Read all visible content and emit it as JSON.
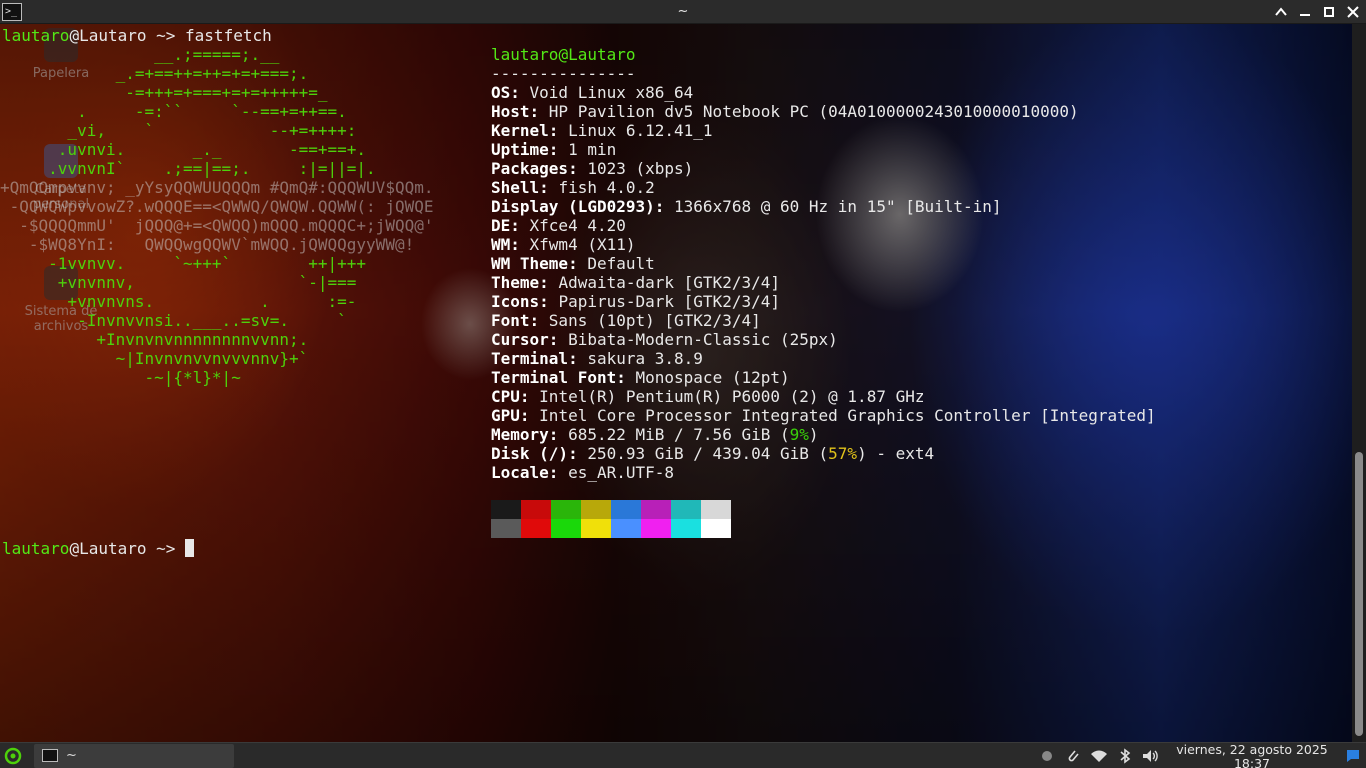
{
  "window": {
    "title": "~",
    "buttons": {
      "maximize": "⌃",
      "minimize": "—",
      "restore": "▫",
      "close": "✕"
    }
  },
  "desktop_icons": [
    {
      "label": "Papelera"
    },
    {
      "label": "Carpeta personal"
    },
    {
      "label": "Sistema de archivos"
    }
  ],
  "terminal": {
    "prompt_user": "lautaro",
    "prompt_host": "@Lautaro",
    "prompt_dir": " ~> ",
    "command": "fastfetch",
    "ascii_logo": [
      "                __.;=====;.__",
      "            _.=+==++=++=+=+===;.",
      "             -=+++=+===+=+=+++++=_",
      "        .     -=:``     `--==+=++==.",
      "       _vi,    `            --+=++++:",
      "      .uvnvi.       _._       -==+==+.",
      "     .vvnvnI`    .;==|==;.     :|=||=|.",
      "+QmQQmpvvnv; _yYsyQQWUUQQQm #QmQ#:QQQWUV$QQm.",
      " -QQWQWpvvowZ?.wQQQE==<QWWQ/QWQW.QQWW(: jQWQE",
      "  -$QQQQmmU'  jQQQ@+=<QWQQ)mQQQ.mQQQC+;jWQQ@'",
      "   -$WQ8YnI:   QWQQwgQQWV`mWQQ.jQWQQgyyWW@!",
      "     -1vvnvv.     `~+++`        ++|+++",
      "      +vnvnnv,                 `-|===",
      "       +vnvnvns.           .      :=-",
      "        -Invnvvnsi..___..=sv=.     `",
      "          +Invnvnvnnnnnnnnvvnn;.",
      "            ~|Invnvnvvnvvvnnv}+`",
      "               -~|{*l}*|~"
    ],
    "info_user": "lautaro",
    "info_host": "@Lautaro",
    "separator": "---------------",
    "info": [
      {
        "label": "OS",
        "value": "Void Linux x86_64"
      },
      {
        "label": "Host",
        "value": "HP Pavilion dv5 Notebook PC (04A0100000243010000010000)"
      },
      {
        "label": "Kernel",
        "value": "Linux 6.12.41_1"
      },
      {
        "label": "Uptime",
        "value": "1 min"
      },
      {
        "label": "Packages",
        "value": "1023 (xbps)"
      },
      {
        "label": "Shell",
        "value": "fish 4.0.2"
      },
      {
        "label": "Display (LGD0293)",
        "value": "1366x768 @ 60 Hz in 15\" [Built-in]"
      },
      {
        "label": "DE",
        "value": "Xfce4 4.20"
      },
      {
        "label": "WM",
        "value": "Xfwm4 (X11)"
      },
      {
        "label": "WM Theme",
        "value": "Default"
      },
      {
        "label": "Theme",
        "value": "Adwaita-dark [GTK2/3/4]"
      },
      {
        "label": "Icons",
        "value": "Papirus-Dark [GTK2/3/4]"
      },
      {
        "label": "Font",
        "value": "Sans (10pt) [GTK2/3/4]"
      },
      {
        "label": "Cursor",
        "value": "Bibata-Modern-Classic (25px)"
      },
      {
        "label": "Terminal",
        "value": "sakura 3.8.9"
      },
      {
        "label": "Terminal Font",
        "value": "Monospace (12pt)"
      },
      {
        "label": "CPU",
        "value": "Intel(R) Pentium(R) P6000 (2) @ 1.87 GHz"
      },
      {
        "label": "GPU",
        "value": "Intel Core Processor Integrated Graphics Controller [Integrated]"
      }
    ],
    "memory": {
      "label": "Memory",
      "value": "685.22 MiB / 7.56 GiB (",
      "pct": "9%",
      "suffix": ")"
    },
    "disk": {
      "label": "Disk (/)",
      "value": "250.93 GiB / 439.04 GiB (",
      "pct": "57%",
      "suffix": ") - ext4"
    },
    "locale": {
      "label": "Locale",
      "value": "es_AR.UTF-8"
    },
    "palette_top": [
      "#1a1a1a",
      "#c80a0a",
      "#2ab50a",
      "#b8a80a",
      "#2a78d8",
      "#b820b8",
      "#20b8b8",
      "#d8d8d8"
    ],
    "palette_bottom": [
      "#5a5a5a",
      "#e00a0a",
      "#1ad80a",
      "#f0e00a",
      "#4a90ff",
      "#f020f0",
      "#1ae0e0",
      "#ffffff"
    ]
  },
  "taskbar": {
    "task_label": "~",
    "clock_date": "viernes, 22 agosto 2025",
    "clock_time": "18:37"
  }
}
